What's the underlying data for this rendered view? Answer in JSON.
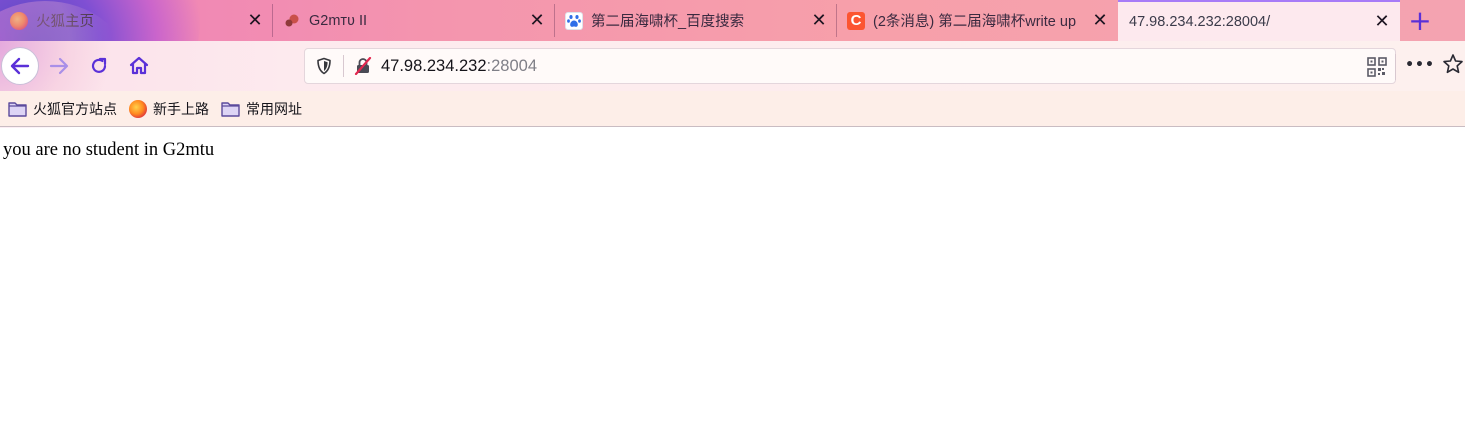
{
  "browser": {
    "tabs": [
      {
        "title": "火狐主页",
        "icon": "firefox-icon",
        "active": false
      },
      {
        "title": "G2mтʋ II",
        "icon": "g2mtu-icon",
        "active": false
      },
      {
        "title": "第二届海啸杯_百度搜索",
        "icon": "baidu-paw-icon",
        "active": false
      },
      {
        "title": "(2条消息) 第二届海啸杯write up",
        "icon": "csdn-c-icon",
        "active": false
      },
      {
        "title": "47.98.234.232:28004/",
        "icon": "",
        "active": true
      }
    ],
    "new_tab_icon": "plus-icon",
    "url": {
      "host": "47.98.234.232",
      "port": ":28004"
    },
    "bookmarks": [
      {
        "label": "火狐官方站点",
        "icon": "folder-icon"
      },
      {
        "label": "新手上路",
        "icon": "firefox-icon"
      },
      {
        "label": "常用网址",
        "icon": "folder-icon"
      }
    ],
    "colors": {
      "accent": "#5a30d8",
      "active_tab_line": "#a77bf7",
      "csdn": "#fc5531"
    }
  },
  "page": {
    "message": "you are no student in G2mtu"
  }
}
